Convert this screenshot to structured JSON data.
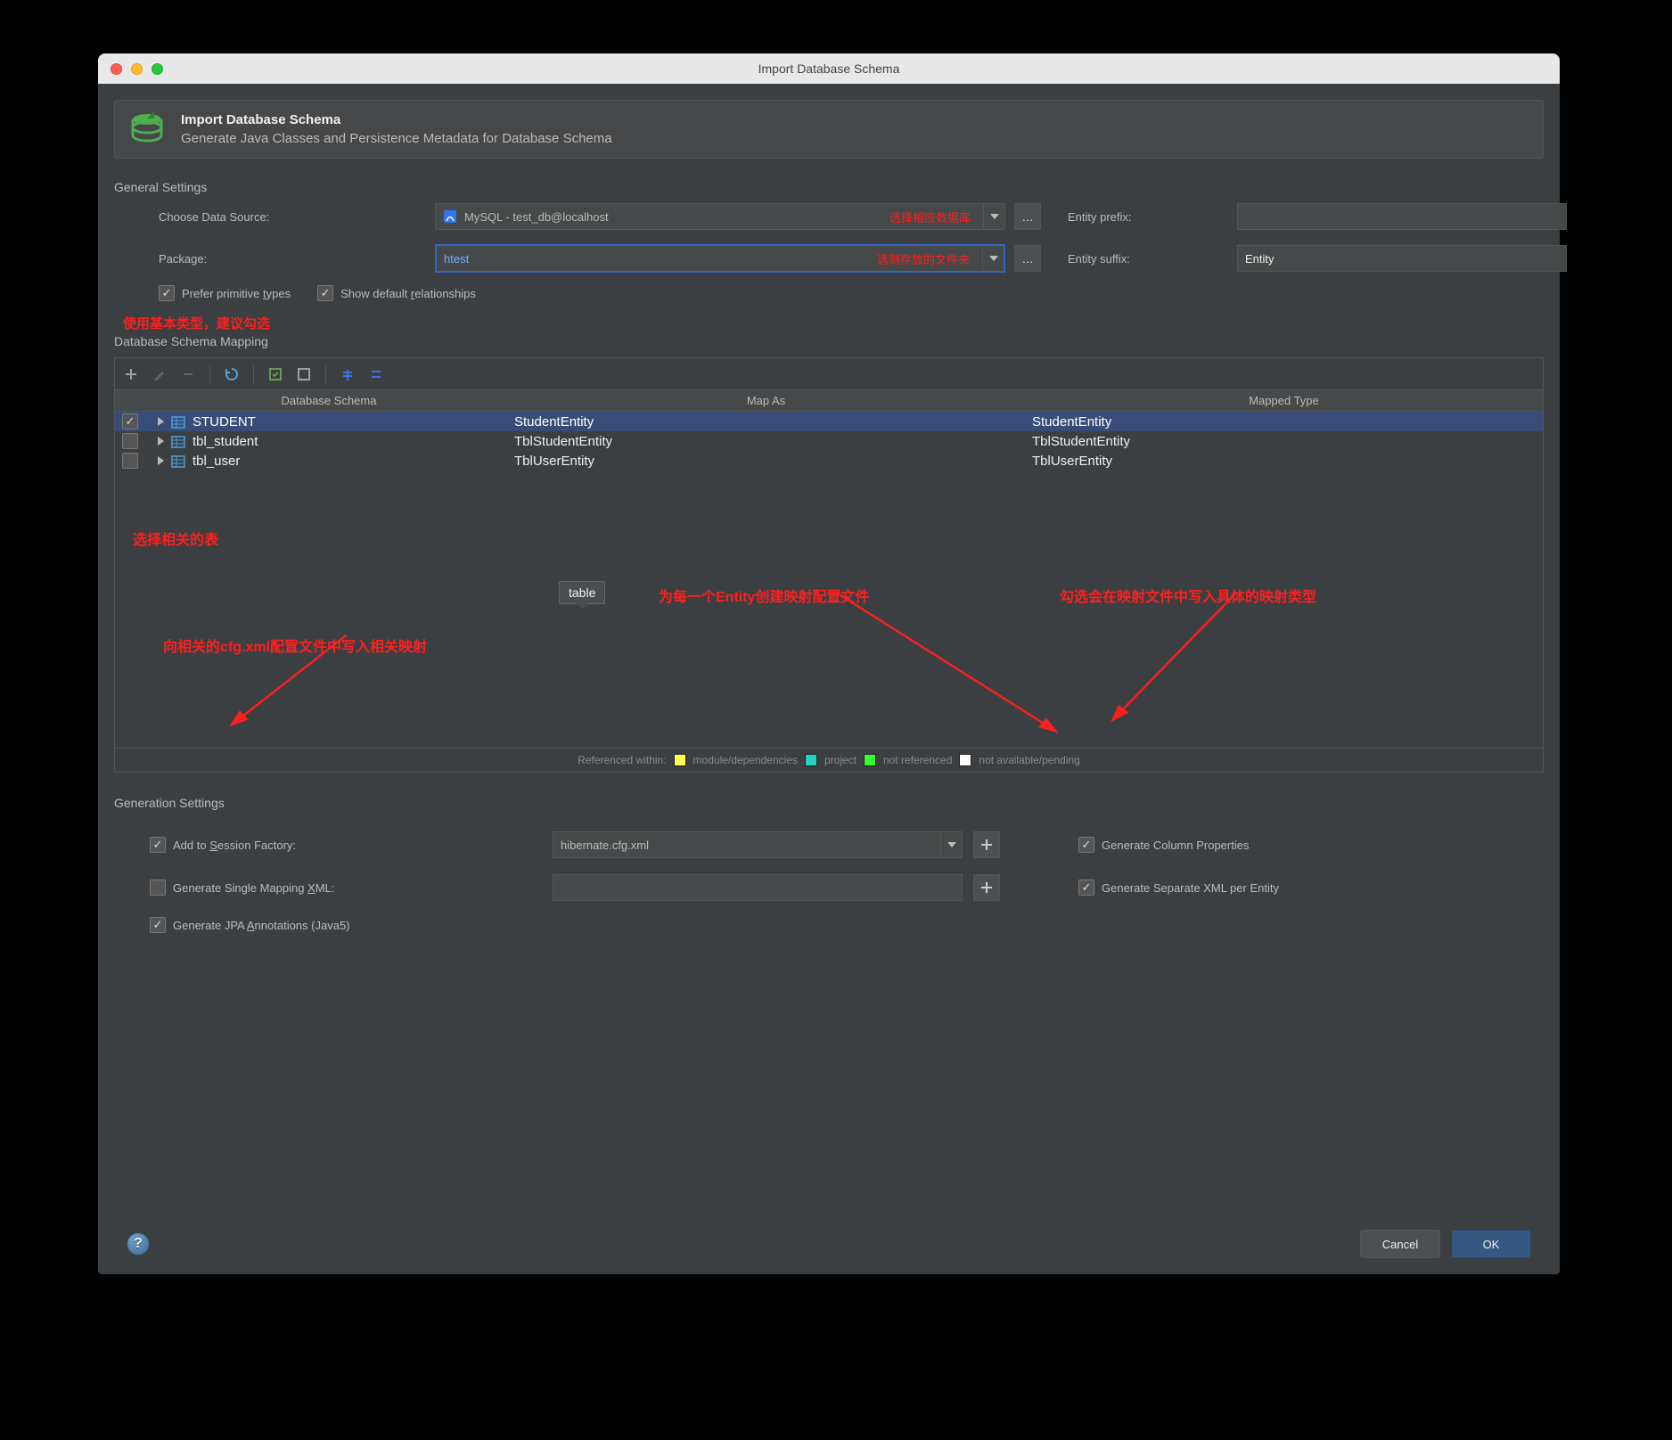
{
  "window": {
    "title": "Import Database Schema"
  },
  "banner": {
    "title": "Import Database Schema",
    "sub": "Generate Java Classes and Persistence Metadata for Database Schema"
  },
  "general": {
    "label": "General Settings",
    "dataSourceLabel": "Choose Data Source:",
    "dataSourceValue": "MySQL - test_db@localhost",
    "dataSourceNote": "选择相应数据库",
    "packageLabel": "Package:",
    "packageValue": "htest",
    "packageNote": "选则存放的文件夹",
    "entityPrefixLabel": "Entity prefix:",
    "entityPrefixValue": "",
    "entitySuffixLabel": "Entity suffix:",
    "entitySuffixValue": "Entity",
    "preferPrimitive": {
      "label_pre": "Prefer primitive ",
      "u": "t",
      "label_post": "ypes",
      "checked": true
    },
    "showDefault": {
      "label_pre": "Show default ",
      "u": "r",
      "label_post": "elationships",
      "checked": true
    },
    "preferNote": "使用基本类型，建议勾选"
  },
  "mapping": {
    "label": "Database Schema Mapping",
    "cols": [
      "Database Schema",
      "Map As",
      "Mapped Type"
    ],
    "rows": [
      {
        "checked": true,
        "name": "STUDENT",
        "mapAs": "StudentEntity",
        "type": "StudentEntity",
        "selected": true
      },
      {
        "checked": false,
        "name": "tbl_student",
        "mapAs": "TblStudentEntity",
        "type": "TblStudentEntity",
        "selected": false
      },
      {
        "checked": false,
        "name": "tbl_user",
        "mapAs": "TblUserEntity",
        "type": "TblUserEntity",
        "selected": false
      }
    ],
    "tooltip": "table",
    "selectTablesNote": "选择相关的表",
    "legend": {
      "prefix": "Referenced within:",
      "items": [
        {
          "color": "#ffff55",
          "label": "module/dependencies"
        },
        {
          "color": "#25d0c7",
          "label": "project"
        },
        {
          "color": "#33ff33",
          "label": "not referenced"
        },
        {
          "color": "#ffffff",
          "label": "not available/pending"
        }
      ]
    }
  },
  "annotations": {
    "cfg": "向相关的cfg.xml配置文件中写入相关映射",
    "perEntity": "为每一个Entity创建映射配置文件",
    "colProps": "勾选会在映射文件中写入具体的映射类型"
  },
  "gen": {
    "label": "Generation Settings",
    "addSession": {
      "label_pre": "Add to ",
      "u": "S",
      "label_post": "ession Factory:",
      "checked": true
    },
    "sessionValue": "hibernate.cfg.xml",
    "genSingle": {
      "label_pre": "Generate Single Mapping ",
      "u": "X",
      "label_post": "ML:",
      "checked": false
    },
    "genSingleValue": "",
    "genJPA": {
      "label_pre": "Generate JPA ",
      "u": "A",
      "label_post": "nnotations (Java5)",
      "checked": true
    },
    "colProps": {
      "label": "Generate Column Properties",
      "checked": true
    },
    "sepXml": {
      "label": "Generate Separate XML per Entity",
      "checked": true
    }
  },
  "footer": {
    "cancel": "Cancel",
    "ok": "OK"
  }
}
